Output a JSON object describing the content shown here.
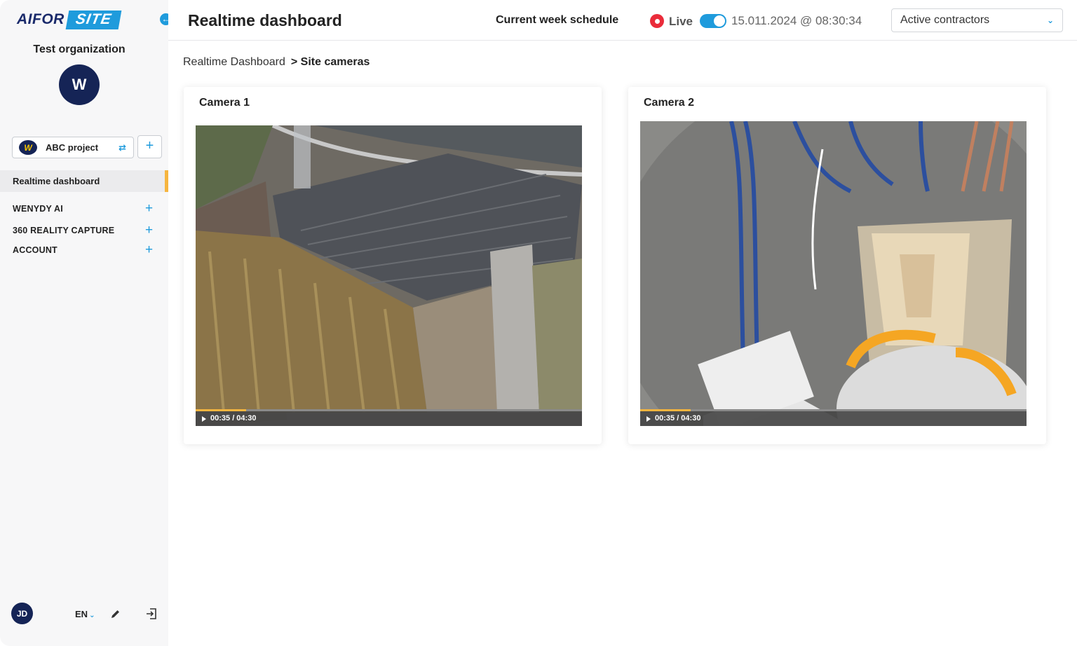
{
  "brand": {
    "logo_left": "AIFOR",
    "logo_right": "SITE"
  },
  "sidebar": {
    "org_name": "Test organization",
    "org_initial": "W",
    "project": {
      "name": "ABC project",
      "logo": "W"
    },
    "active_item": "Realtime dashboard",
    "items": [
      {
        "label": "WENYDY AI"
      },
      {
        "label": "360 REALITY CAPTURE"
      },
      {
        "label": "ACCOUNT"
      }
    ],
    "user_initials": "JD",
    "language": "EN"
  },
  "header": {
    "title": "Realtime dashboard",
    "schedule": "Current week schedule",
    "live_label": "Live",
    "live_on": true,
    "datetime": "15.011.2024 @ 08:30:34",
    "contractor_select": "Active contractors"
  },
  "breadcrumb": {
    "parent": "Realtime Dashboard",
    "current": "> Site cameras"
  },
  "cameras": [
    {
      "title": "Camera 1",
      "time": "00:35 / 04:30",
      "progress": 0.13
    },
    {
      "title": "Camera 2",
      "time": "00:35 / 04:30",
      "progress": 0.13
    }
  ],
  "colors": {
    "accent": "#1f9bdc",
    "navy": "#152456",
    "active_bar": "#f6b53f",
    "live": "#ea2c3a"
  }
}
